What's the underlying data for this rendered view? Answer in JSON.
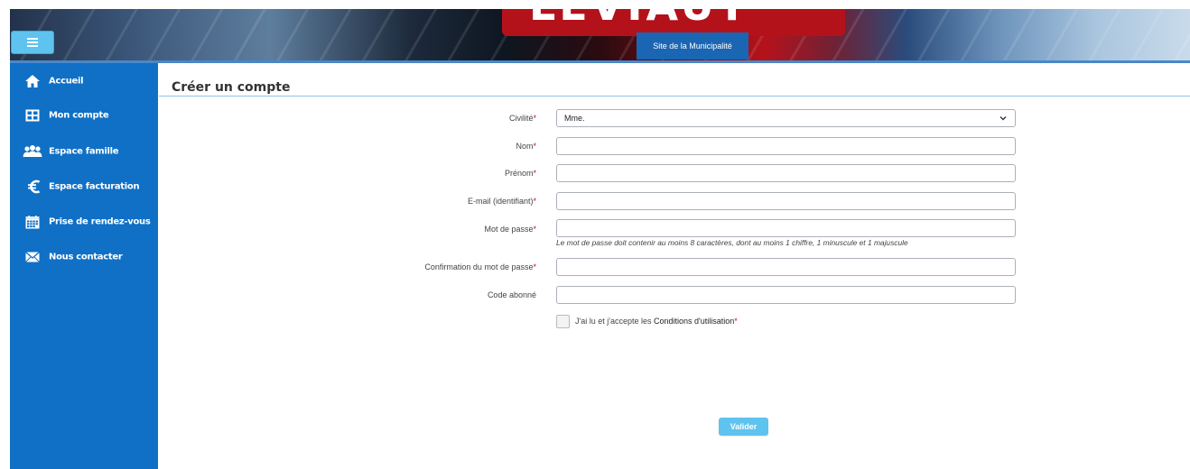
{
  "banner": {
    "logo_text": "LEVIAUT",
    "site_link_label": "Site de la Municipalité",
    "menu_icon": "hamburger-icon"
  },
  "sidebar": {
    "items": [
      {
        "label": "Accueil",
        "icon": "home-icon"
      },
      {
        "label": "Mon compte",
        "icon": "grid-icon"
      },
      {
        "label": "Espace famille",
        "icon": "family-icon"
      },
      {
        "label": "Espace facturation",
        "icon": "euro-icon"
      },
      {
        "label": "Prise de rendez-vous",
        "icon": "calendar-icon"
      },
      {
        "label": "Nous contacter",
        "icon": "envelope-icon"
      }
    ]
  },
  "page": {
    "title": "Créer un compte"
  },
  "form": {
    "required_mark": "*",
    "civilite": {
      "label": "Civilité",
      "value": "Mme."
    },
    "nom": {
      "label": "Nom",
      "value": ""
    },
    "prenom": {
      "label": "Prénom",
      "value": ""
    },
    "email": {
      "label": "E-mail (identifiant)",
      "value": ""
    },
    "password": {
      "label": "Mot de passe",
      "value": "",
      "hint": "Le mot de passe doit contenir au moins 8 caractères, dont au moins 1 chiffre, 1 minuscule et 1 majuscule"
    },
    "password_confirm": {
      "label": "Confirmation du mot de passe",
      "value": ""
    },
    "code_abonne": {
      "label": "Code abonné",
      "value": ""
    },
    "terms": {
      "prefix": "J'ai lu et j'accepte les ",
      "link": "Conditions d'utilisation",
      "checked": false
    },
    "submit_label": "Valider"
  },
  "colors": {
    "sidebar_bg": "#0f70c6",
    "accent": "#5ec3ee",
    "required": "#c0121b",
    "site_link_bg": "#1b66b3"
  }
}
